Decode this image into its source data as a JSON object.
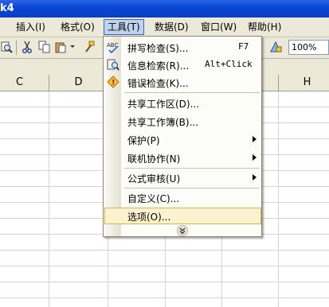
{
  "window": {
    "title": "k4"
  },
  "menubar": {
    "items": [
      {
        "label": "插入(I)",
        "active": false
      },
      {
        "label": "格式(O)",
        "active": false
      },
      {
        "label": "工具(T)",
        "active": true
      },
      {
        "label": "数据(D)",
        "active": false
      },
      {
        "label": "窗口(W)",
        "active": false
      },
      {
        "label": "帮助(H)",
        "active": false
      }
    ]
  },
  "toolbar": {
    "zoom": "100%"
  },
  "columns": [
    "C",
    "D",
    "H"
  ],
  "tools_menu": {
    "items": [
      {
        "label": "拼写检查(S)...",
        "shortcut": "F7",
        "icon": "spellcheck-icon"
      },
      {
        "label": "信息检索(R)...",
        "shortcut": "Alt+Click",
        "icon": "research-icon"
      },
      {
        "label": "错误检查(K)...",
        "icon": "error-check-icon"
      },
      {
        "label": "共享工作区(D)..."
      },
      {
        "label": "共享工作簿(B)..."
      },
      {
        "label": "保护(P)",
        "submenu": true
      },
      {
        "label": "联机协作(N)",
        "submenu": true
      },
      {
        "label": "公式审核(U)",
        "submenu": true
      },
      {
        "label": "自定义(C)..."
      },
      {
        "label": "选项(O)...",
        "highlighted": true
      }
    ],
    "expand_label": "⌄⌄"
  }
}
